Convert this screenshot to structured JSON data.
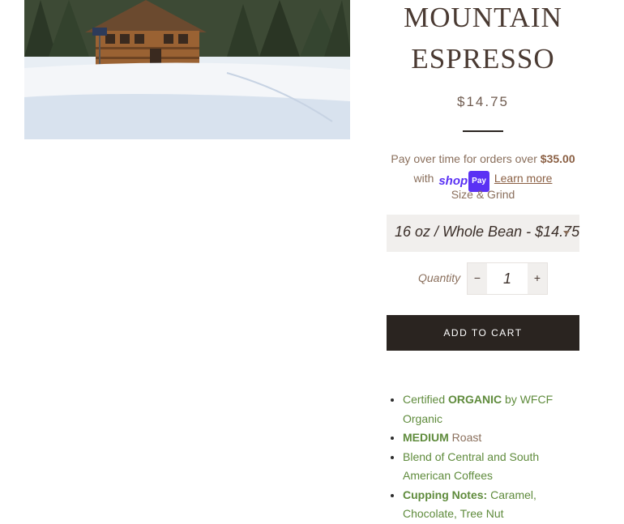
{
  "product": {
    "title": "MOUNTAIN ESPRESSO",
    "price": "$14.75"
  },
  "installments": {
    "text_before": "Pay over time for orders over",
    "threshold": "$35.00",
    "with": "with",
    "shop": "shop",
    "pay": "Pay",
    "learn_more": "Learn more"
  },
  "variant": {
    "label": "Size & Grind",
    "selected": "16 oz / Whole Bean - $14.75"
  },
  "quantity": {
    "label": "Quantity",
    "value": "1",
    "minus": "−",
    "plus": "+"
  },
  "cart": {
    "add_label": "ADD TO CART"
  },
  "description": {
    "items": [
      {
        "pre": "Certified ",
        "bold": "ORGANIC",
        "post": " by WFCF Organic"
      },
      {
        "pre": "",
        "bold": "MEDIUM",
        "post": " Roast"
      },
      {
        "pre": "Blend of Central and South American Coffees",
        "bold": "",
        "post": ""
      },
      {
        "pre": "",
        "bold": "Cupping Notes:",
        "post": " Caramel, Chocolate, Tree Nut"
      }
    ]
  },
  "colors": {
    "accent_green": "#5f8b3c",
    "brown_text": "#8a6f5c",
    "dark_button": "#2a2420",
    "shop_pay_purple": "#5a31f4"
  },
  "icons": {
    "dropdown": "chevron-down-icon"
  }
}
